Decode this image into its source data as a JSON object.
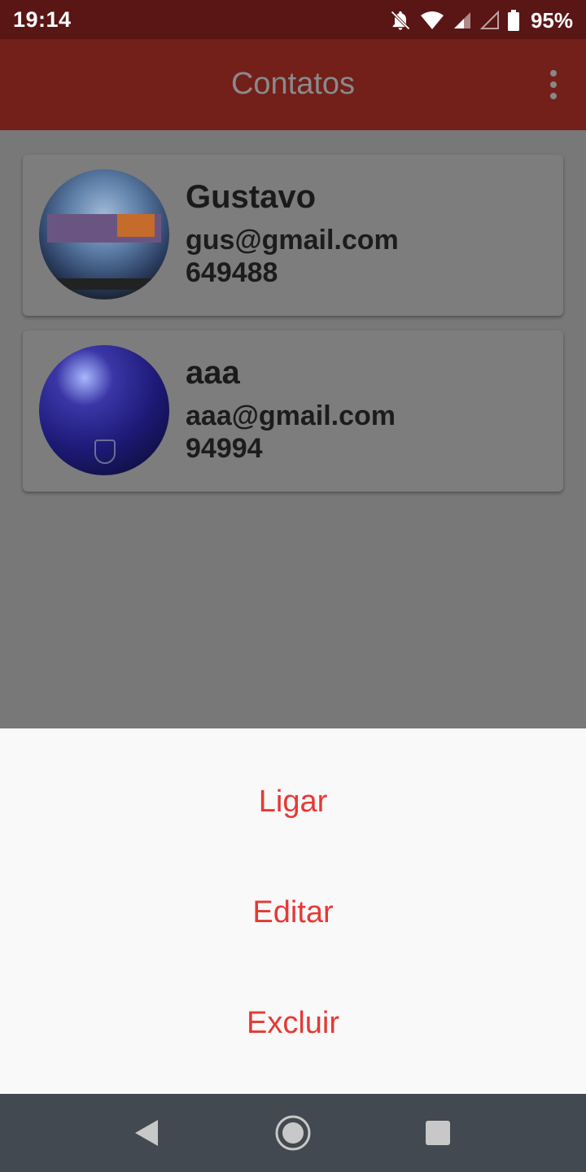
{
  "status_bar": {
    "time": "19:14",
    "battery_percent": "95%",
    "icons": [
      "notifications-off-icon",
      "wifi-icon",
      "signal-icon",
      "signal-empty-icon",
      "battery-icon"
    ]
  },
  "app_bar": {
    "title": "Contatos",
    "menu_icon": "more-vert-icon"
  },
  "contacts": [
    {
      "name": "Gustavo",
      "email": "gus@gmail.com",
      "phone": "649488"
    },
    {
      "name": "aaa",
      "email": "aaa@gmail.com",
      "phone": "94994"
    }
  ],
  "bottom_sheet": {
    "options": [
      "Ligar",
      "Editar",
      "Excluir"
    ]
  },
  "navigation": {
    "icons": [
      "back-icon",
      "home-icon",
      "recents-icon"
    ]
  },
  "colors": {
    "status_bar": "#5a1515",
    "app_bar": "#731f1a",
    "accent": "#e53935",
    "scrim_background": "#787878",
    "sheet_background": "#f9f9f9",
    "nav_bar": "#424950"
  }
}
